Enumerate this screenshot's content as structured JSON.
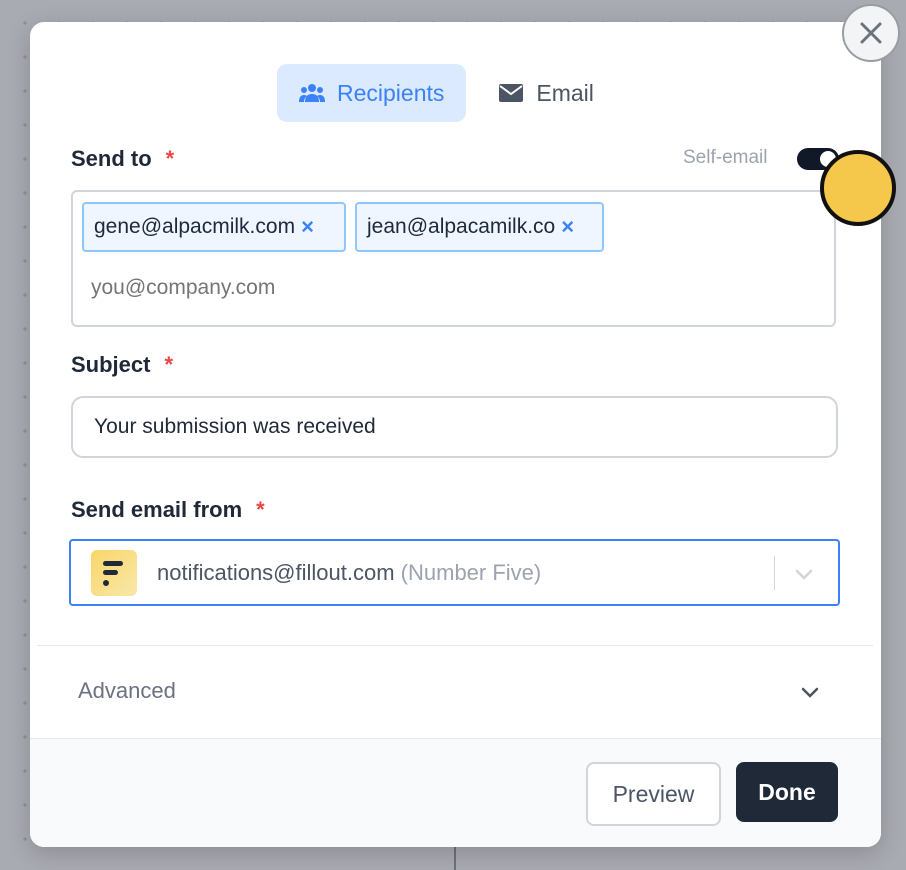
{
  "tabs": [
    {
      "label": "Recipients",
      "icon": "users-icon",
      "active": true
    },
    {
      "label": "Email",
      "icon": "envelope-icon",
      "active": false
    }
  ],
  "send_to": {
    "label": "Send to",
    "required_mark": "*",
    "self_email_label": "Self-email",
    "self_email_on": true,
    "recipients": [
      "gene@alpacmilk.com",
      "jean@alpacamilk.co"
    ],
    "chip_remove": "×",
    "placeholder": "you@company.com"
  },
  "subject": {
    "label": "Subject",
    "required_mark": "*",
    "value": "Your submission was received"
  },
  "send_from": {
    "label": "Send email from",
    "required_mark": "*",
    "address": "notifications@fillout.com",
    "account": "(Number Five)"
  },
  "advanced": {
    "label": "Advanced"
  },
  "footer": {
    "preview_label": "Preview",
    "done_label": "Done"
  },
  "colors": {
    "accent": "#3b82f6",
    "required": "#ef4444",
    "done_bg": "#1f2937",
    "cursor": "#f5c84c"
  }
}
